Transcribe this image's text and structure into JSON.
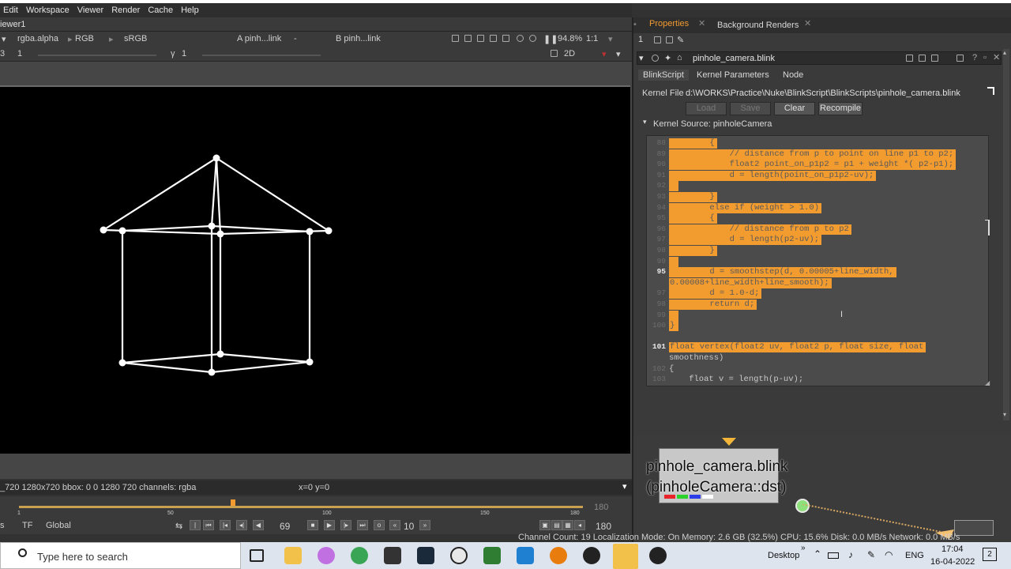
{
  "menubar": {
    "items": [
      "Edit",
      "Workspace",
      "Viewer",
      "Render",
      "Cache",
      "Help"
    ]
  },
  "viewer": {
    "tab_label": "iewer1",
    "channels": "rgba.alpha",
    "colorspace": "RGB",
    "lut": "sRGB",
    "input_a": "A  pinh...link",
    "input_a_op": "-",
    "input_b": "B  pinh...link",
    "zoom": "94.8%",
    "ratio": "1:1",
    "gain_label": "3",
    "gain_value": "1",
    "gamma_label": "γ",
    "gamma_value": "1",
    "view_mode": "2D",
    "info_bar": "_720 1280x720  bbox: 0 0 1280 720 channels: rgba",
    "cursor_info": "x=0 y=0"
  },
  "timeline": {
    "ticks": [
      "1",
      "50",
      "100",
      "150",
      "180"
    ],
    "end_frame": "180",
    "current_frame": "69",
    "tf_label": "TF",
    "global_label": "Global",
    "step": "10",
    "end_frame_2": "180",
    "playhead_fraction": 0.38
  },
  "properties": {
    "tab_properties": "Properties",
    "tab_background": "Background Renders",
    "count": "1",
    "node_name": "pinhole_camera.blink",
    "node_tabs": [
      "BlinkScript",
      "Kernel Parameters",
      "Node"
    ],
    "kernel_file_label": "Kernel File",
    "kernel_file_path": "d:\\WORKS\\Practice\\Nuke\\BlinkScript\\BlinkScripts\\pinhole_camera.blink",
    "buttons": {
      "load": "Load",
      "save": "Save",
      "clear": "Clear",
      "recompile": "Recompile"
    },
    "kernel_source_label": "Kernel Source: pinholeCamera",
    "code_lines": [
      {
        "ln": "88",
        "text": "        {",
        "hl": true,
        "strong": false
      },
      {
        "ln": "89",
        "text": "            // distance from p to point on line p1 to p2;",
        "hl": true,
        "strong": false
      },
      {
        "ln": "90",
        "text": "            float2 point_on_p1p2 = p1 + weight *( p2-p1);",
        "hl": true,
        "strong": false
      },
      {
        "ln": "91",
        "text": "            d = length(point_on_p1p2-uv);",
        "hl": true,
        "strong": false
      },
      {
        "ln": "92",
        "text": "",
        "hl": true,
        "strong": false
      },
      {
        "ln": "93",
        "text": "        }",
        "hl": true,
        "strong": false
      },
      {
        "ln": "94",
        "text": "        else if (weight > 1.0)",
        "hl": true,
        "strong": false
      },
      {
        "ln": "95",
        "text": "        {",
        "hl": true,
        "strong": false
      },
      {
        "ln": "96",
        "text": "            // distance from p to p2",
        "hl": true,
        "strong": false
      },
      {
        "ln": "97",
        "text": "            d = length(p2-uv);",
        "hl": true,
        "strong": false
      },
      {
        "ln": "98",
        "text": "        }",
        "hl": true,
        "strong": false
      },
      {
        "ln": "99",
        "text": "",
        "hl": true,
        "strong": false
      },
      {
        "ln": "95",
        "text": "        d = smoothstep(d, 0.00005+line_width,",
        "hl": true,
        "strong": true
      },
      {
        "ln": "",
        "text": "0.00008+line_width+line_smooth);",
        "hl": true,
        "strong": false
      },
      {
        "ln": "97",
        "text": "        d = 1.0-d;",
        "hl": true,
        "strong": false
      },
      {
        "ln": "98",
        "text": "        return d;",
        "hl": true,
        "strong": false
      },
      {
        "ln": "99",
        "text": "",
        "hl": true,
        "strong": false
      },
      {
        "ln": "100",
        "text": "}",
        "hl": true,
        "strong": false
      },
      {
        "ln": "",
        "text": "",
        "hl": false,
        "strong": false
      },
      {
        "ln": "101",
        "text": "float vertex(float2 uv, float2 p, float size, float",
        "hl": true,
        "strong": true
      },
      {
        "ln": "",
        "text": "smoothness)",
        "hl": false,
        "strong": false
      },
      {
        "ln": "102",
        "text": "{",
        "hl": false,
        "strong": false
      },
      {
        "ln": "103",
        "text": "    float v = length(p-uv);",
        "hl": false,
        "strong": false
      }
    ]
  },
  "nodegraph": {
    "node_title_line1": "pinhole_camera.blink",
    "node_title_line2": "(pinholeCamera::dst)",
    "status": "Channel Count: 19 Localization Mode: On Memory: 2.6 GB (32.5%) CPU: 15.6% Disk: 0.0 MB/s Network: 0.0 MB/s"
  },
  "taskbar": {
    "search_placeholder": "Type here to search",
    "desktop_label": "Desktop",
    "lang": "ENG",
    "time": "17:04",
    "date": "16-04-2022",
    "notif_count": "2"
  },
  "colors": {
    "accent_orange": "#f29b2f",
    "node_gray": "#c8c8c8",
    "viewer_bg": "#000000"
  }
}
